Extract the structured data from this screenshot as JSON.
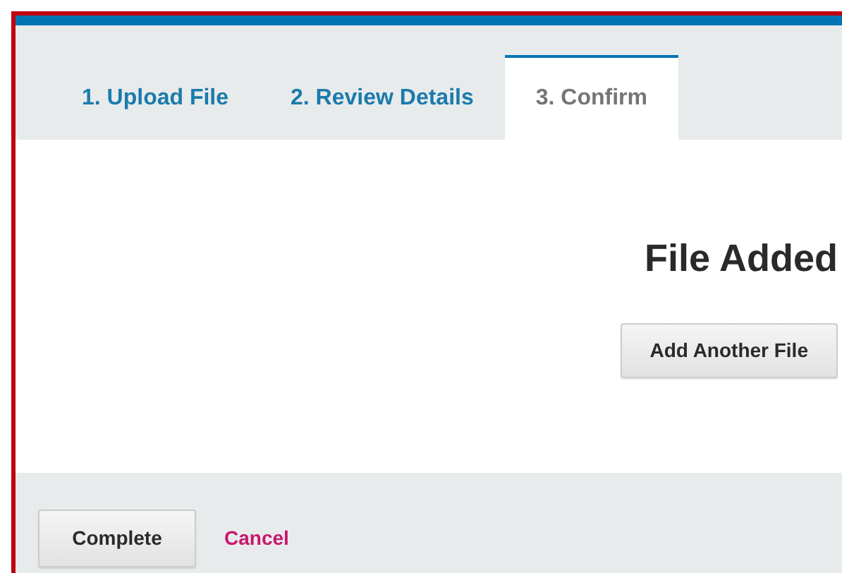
{
  "tabs": [
    {
      "label": "1. Upload File",
      "selected": false
    },
    {
      "label": "2. Review Details",
      "selected": false
    },
    {
      "label": "3. Confirm",
      "selected": true
    }
  ],
  "heading": "File Added",
  "add_button": "Add Another File",
  "footer": {
    "primary_button": "Complete",
    "cancel_link": "Cancel"
  }
}
